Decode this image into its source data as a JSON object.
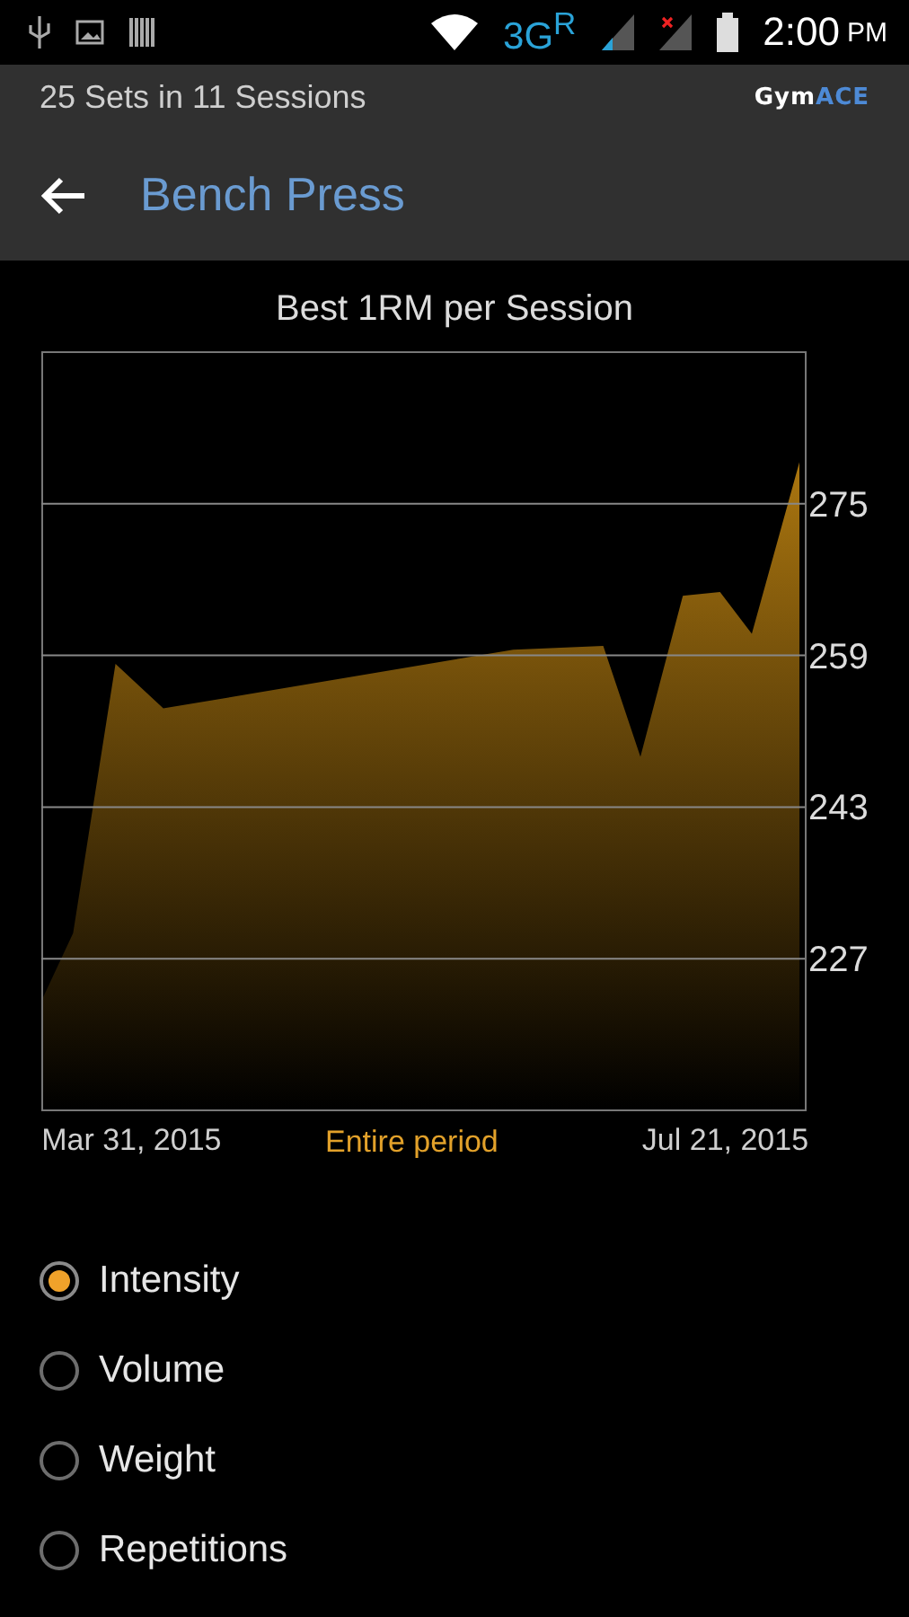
{
  "status_bar": {
    "network": "3G$^{R}$",
    "time": "2:00",
    "time_suffix": "PM"
  },
  "header": {
    "subtitle": "25 Sets in 11 Sessions",
    "logo": {
      "first": "Gym",
      "second": "ACE"
    },
    "title": "Bench Press"
  },
  "chart": {
    "period": "Entire period",
    "chart_data": {
      "type": "area",
      "grid": true,
      "title": "Best 1RM per Session",
      "x": [
        "2015-03-14",
        "2015-03-20",
        "2015-03-28",
        "2015-04-06",
        "2015-06-11",
        "2015-06-28",
        "2015-07-05",
        "2015-07-13",
        "2015-07-20",
        "2015-07-26",
        "2015-08-04"
      ],
      "series": [
        {
          "color": "#c88a12",
          "values": [
            222.5,
            229.7,
            258.1,
            253.4,
            259.6,
            260.0,
            248.3,
            265.3,
            265.7,
            261.3,
            279.4
          ]
        }
      ],
      "ylim": [
        211,
        291
      ],
      "yticks": [
        {
          "value": 227,
          "label": "227"
        },
        {
          "value": 243,
          "label": "243"
        },
        {
          "value": 259,
          "label": "259"
        },
        {
          "value": 275,
          "label": "275"
        }
      ],
      "xlim": [
        "2015-03-14",
        "2015-08-05"
      ],
      "xticks": [
        {
          "value": "2015-03-31",
          "label": "Mar 31, 2015"
        },
        {
          "value": "2015-07-21",
          "label": "Jul 21, 2015"
        }
      ]
    }
  },
  "chart_options": [
    {
      "label": "Intensity",
      "selected": true
    },
    {
      "label": "Volume",
      "selected": false
    },
    {
      "label": "Weight",
      "selected": false
    },
    {
      "label": "Repetitions",
      "selected": false
    }
  ]
}
